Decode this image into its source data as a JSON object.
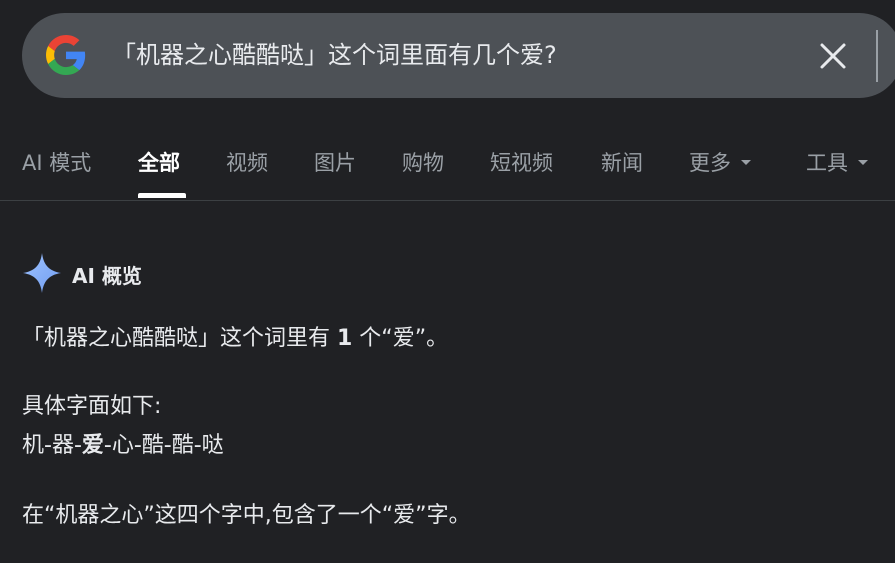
{
  "search": {
    "query": "「机器之心酷酷哒」这个词里面有几个爱?"
  },
  "tabs": [
    {
      "label": "AI 模式"
    },
    {
      "label": "全部"
    },
    {
      "label": "视频"
    },
    {
      "label": "图片"
    },
    {
      "label": "购物"
    },
    {
      "label": "短视频"
    },
    {
      "label": "新闻"
    },
    {
      "label": "更多"
    },
    {
      "label": "工具"
    }
  ],
  "ai_overview": {
    "title": "AI 概览",
    "answer_prefix": "「机器之心酷酷哒」这个词里有 ",
    "answer_count": "1",
    "answer_suffix": " 个“爱”。",
    "detail_heading": "具体字面如下:",
    "breakdown_prefix": "机-器-",
    "breakdown_highlight": "爱",
    "breakdown_suffix": "-心-酷-酷-哒",
    "explanation": "在“机器之心”这四个字中,包含了一个“爱”字。"
  },
  "colors": {
    "background": "#202124",
    "search_bar": "#4d5156",
    "text_primary": "#e8eaed",
    "text_secondary": "#9aa0a6",
    "sparkle": "#8ab4f8"
  }
}
